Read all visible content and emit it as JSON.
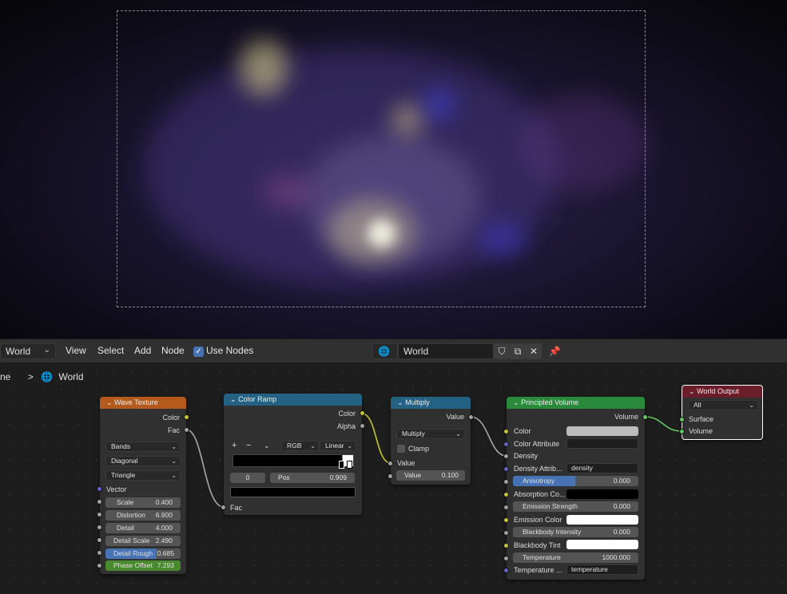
{
  "header": {
    "world_select": "World",
    "menu": [
      "View",
      "Select",
      "Add",
      "Node"
    ],
    "use_nodes_label": "Use Nodes",
    "world_name": "World"
  },
  "breadcrumb": {
    "prefix": "ne",
    "sep": ">",
    "item": "World"
  },
  "nodes": {
    "wave": {
      "title": "Wave Texture",
      "out_color": "Color",
      "out_fac": "Fac",
      "type": "Bands",
      "direction": "Diagonal",
      "profile": "Triangle",
      "vector": "Vector",
      "scale": {
        "label": "Scale",
        "value": "0.400"
      },
      "distortion": {
        "label": "Distortion",
        "value": "6.900"
      },
      "detail": {
        "label": "Detail",
        "value": "4.000"
      },
      "detail_scale": {
        "label": "Detail Scale",
        "value": "2.490"
      },
      "detail_rough": {
        "label": "Detail Rough",
        "value": "0.685"
      },
      "phase_offset": {
        "label": "Phase Offset",
        "value": "7.293"
      }
    },
    "ramp": {
      "title": "Color Ramp",
      "out_color": "Color",
      "out_alpha": "Alpha",
      "add": "+",
      "remove": "−",
      "mode": "RGB",
      "interp": "Linear",
      "index": "0",
      "pos_label": "Pos",
      "pos_value": "0.909",
      "in_fac": "Fac"
    },
    "multiply": {
      "title": "Multiply",
      "out_value": "Value",
      "op": "Multiply",
      "clamp": "Clamp",
      "in_value": "Value",
      "value_label": "Value",
      "value_value": "0.100"
    },
    "volume": {
      "title": "Principled Volume",
      "out_volume": "Volume",
      "color": "Color",
      "color_attr": "Color Attribute",
      "density": "Density",
      "density_attr": "Density Attrib...",
      "density_attr_val": "density",
      "anisotropy": {
        "label": "Anisotropy",
        "value": "0.000"
      },
      "absorption": "Absorption Co...",
      "emission_strength": {
        "label": "Emission Strength",
        "value": "0.000"
      },
      "emission_color": "Emission Color",
      "blackbody_intensity": {
        "label": "Blackbody Intensity",
        "value": "0.000"
      },
      "blackbody_tint": "Blackbody Tint",
      "temperature": {
        "label": "Temperature",
        "value": "1000.000"
      },
      "temperature_attr": "Temperature ...",
      "temperature_attr_val": "temperature"
    },
    "output": {
      "title": "World Output",
      "target": "All",
      "surface": "Surface",
      "volume": "Volume"
    }
  },
  "colors": {
    "texture_header": "#b55a1d",
    "converter_header": "#246283",
    "shader_header": "#2a8a3c",
    "output_header": "#6b1d2a",
    "accent": "#4772b3"
  }
}
